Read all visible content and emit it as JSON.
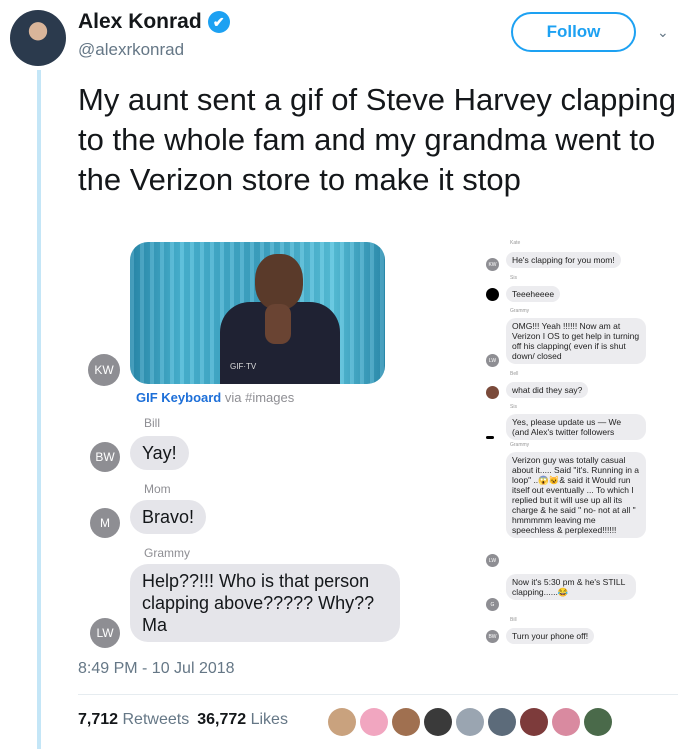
{
  "author": {
    "name": "Alex Konrad",
    "handle": "@alexrkonrad",
    "verified_icon": "✔"
  },
  "follow_label": "Follow",
  "caret_icon": "⌄",
  "tweet_text": "My aunt sent a gif of Steve Harvey clapping to the whole fam and my grandma went to the Verizon store to make it stop",
  "media": {
    "gif_tag": "GIF·TV",
    "kw_initials": "KW",
    "gif_source_name": "GIF Keyboard",
    "gif_source_suffix": " via #images",
    "messages": [
      {
        "sender": "Bill",
        "initials": "BW",
        "text": "Yay!"
      },
      {
        "sender": "Mom",
        "initials": "M",
        "text": "Bravo!"
      },
      {
        "sender": "Grammy",
        "initials": "LW",
        "text": "Help??!!! Who is that person clapping  above????? Why?? Ma"
      }
    ],
    "right_chat": [
      {
        "name": "Kate",
        "initials": "KW",
        "text": "He's clapping for you mom!"
      },
      {
        "name": "Sis",
        "initials": "",
        "text": "Teeeheeee"
      },
      {
        "name": "Grammy",
        "initials": "LW",
        "text": "OMG!!! Yeah !!!!!! Now am at Verizon I OS to get help in turning off his clapping( even if is shut down/ closed"
      },
      {
        "name": "Bell",
        "initials": "",
        "text": "what did they say?"
      },
      {
        "name": "Sis",
        "initials": "",
        "text": "Yes, please update us — We (and Alex's twitter followers"
      },
      {
        "name": "Grammy",
        "initials": "LW",
        "text": "Verizon guy was totally casual about it..... Said \"it's. Running in a loop\" ..😱😺& said it Would run itself out eventually ... To which I replied but it will use up all its charge & he said \" no- not at all \" hmmmmm leaving me speechless & perplexed!!!!!!"
      },
      {
        "name": "",
        "initials": "G",
        "text": "Now it's 5:30 pm & he's STILL clapping......😂"
      },
      {
        "name": "Bill",
        "initials": "BW",
        "text": "Turn your phone off!"
      }
    ]
  },
  "timestamp": "8:49 PM - 10 Jul 2018",
  "stats": {
    "retweets_count": "7,712",
    "retweets_label": "Retweets",
    "likes_count": "36,772",
    "likes_label": "Likes"
  },
  "liker_colors": [
    "#c9a27e",
    "#f1a6c0",
    "#a07050",
    "#3a3a3a",
    "#9aa5b1",
    "#5c6b7a",
    "#7d3b3b",
    "#d98aa0",
    "#4a6a4a"
  ]
}
